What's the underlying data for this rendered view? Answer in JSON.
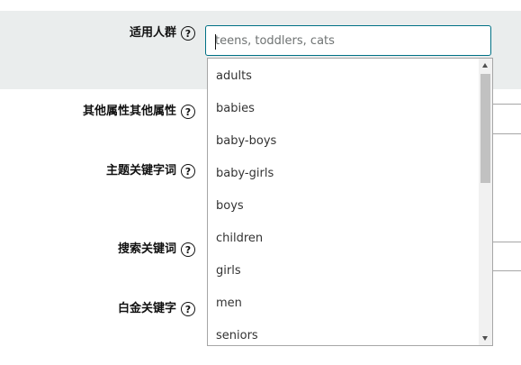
{
  "form": {
    "fields": [
      {
        "label": "适用人群"
      },
      {
        "label": "其他属性其他属性"
      },
      {
        "label": "主题关键字词"
      },
      {
        "label": "搜索关键词"
      },
      {
        "label": "白金关键字"
      }
    ],
    "help_glyph": "?"
  },
  "target_audience": {
    "placeholder": "teens, toddlers, cats",
    "value": "",
    "suggestions": [
      "adults",
      "babies",
      "baby-boys",
      "baby-girls",
      "boys",
      "children",
      "girls",
      "men",
      "seniors"
    ]
  },
  "colors": {
    "highlight_row": "#eaeded",
    "input_focus_border": "#007185"
  }
}
